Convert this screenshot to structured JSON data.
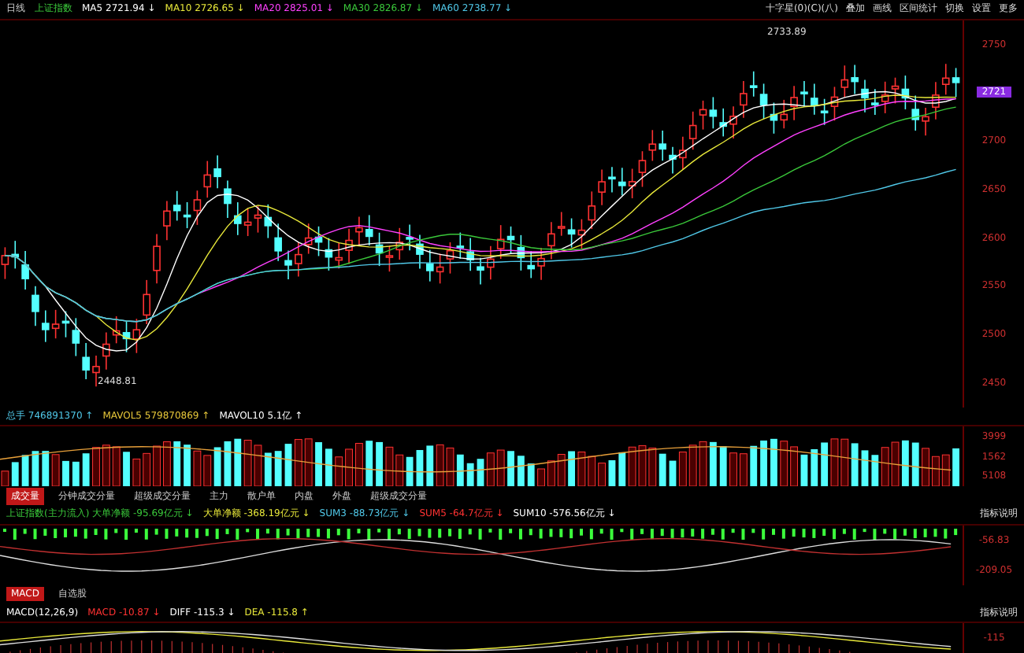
{
  "header": {
    "period": "日线",
    "index_name": "上证指数",
    "ma_items": [
      {
        "text": "MA5 2721.94 ↓",
        "color": "#ffffff"
      },
      {
        "text": "MA10 2726.65 ↓",
        "color": "#e8e83a"
      },
      {
        "text": "MA20 2825.01 ↓",
        "color": "#ff40ff"
      },
      {
        "text": "MA30 2826.87 ↓",
        "color": "#3ac83a"
      },
      {
        "text": "MA60 2738.77 ↓",
        "color": "#50c8e8"
      }
    ]
  },
  "menu": [
    "十字星(0)(C)(八)",
    "叠加",
    "画线",
    "区间统计",
    "切换",
    "设置",
    "更多"
  ],
  "price_axis": [
    {
      "label": "2750",
      "kind": "tick"
    },
    {
      "label": "2721",
      "kind": "current"
    },
    {
      "label": "2700",
      "kind": "tick"
    },
    {
      "label": "2650",
      "kind": "tick"
    },
    {
      "label": "2600",
      "kind": "tick"
    },
    {
      "label": "2550",
      "kind": "tick"
    },
    {
      "label": "2500",
      "kind": "tick"
    },
    {
      "label": "2450",
      "kind": "tick"
    }
  ],
  "high_label": "2733.89",
  "low_label": "2448.81",
  "volume": {
    "items": [
      {
        "text": "总手 746891370 ↑",
        "color": "#50c8e8"
      },
      {
        "text": "MAVOL5 579870869 ↑",
        "color": "#e8c83a"
      },
      {
        "text": "MAVOL10 5.1亿 ↑",
        "color": "#ffffff"
      }
    ],
    "axis": [
      "3999",
      "1562",
      "5108"
    ]
  },
  "tabs": [
    {
      "label": "成交量",
      "selected": true
    },
    {
      "label": "分钟成交分量",
      "selected": false
    },
    {
      "label": "超级成交分量",
      "selected": false
    },
    {
      "label": "主力",
      "selected": false
    },
    {
      "label": "散户单",
      "selected": false
    },
    {
      "label": "内盘",
      "selected": false
    },
    {
      "label": "外盘",
      "selected": false
    },
    {
      "label": "超级成交分量",
      "selected": false
    }
  ],
  "funds": {
    "items": [
      {
        "text": "上证指数(主力流入) 大单净额 -95.69亿元 ↓",
        "color": "#3ac83a"
      },
      {
        "text": "大单净额 -368.19亿元 ↓",
        "color": "#e8e83a"
      },
      {
        "text": "SUM3 -88.73亿元 ↓",
        "color": "#50c8e8"
      },
      {
        "text": "SUM5 -64.7亿元 ↓",
        "color": "#ff3232"
      },
      {
        "text": "SUM10 -576.56亿元 ↓",
        "color": "#ffffff"
      }
    ],
    "right_label": "指标说明",
    "axis": [
      "-56.83",
      "-209.05"
    ]
  },
  "macd": {
    "tabs": [
      {
        "label": "MACD",
        "selected": true
      },
      {
        "label": "自选股",
        "selected": false
      }
    ],
    "items": [
      {
        "text": "MACD(12,26,9)",
        "color": "#ffffff"
      },
      {
        "text": "MACD -10.87 ↓",
        "color": "#ff3232"
      },
      {
        "text": "DIFF -115.3 ↓",
        "color": "#ffffff"
      },
      {
        "text": "DEA -115.8 ↑",
        "color": "#e8e83a"
      }
    ],
    "right_label": "指标说明",
    "axis": "-115"
  }
}
